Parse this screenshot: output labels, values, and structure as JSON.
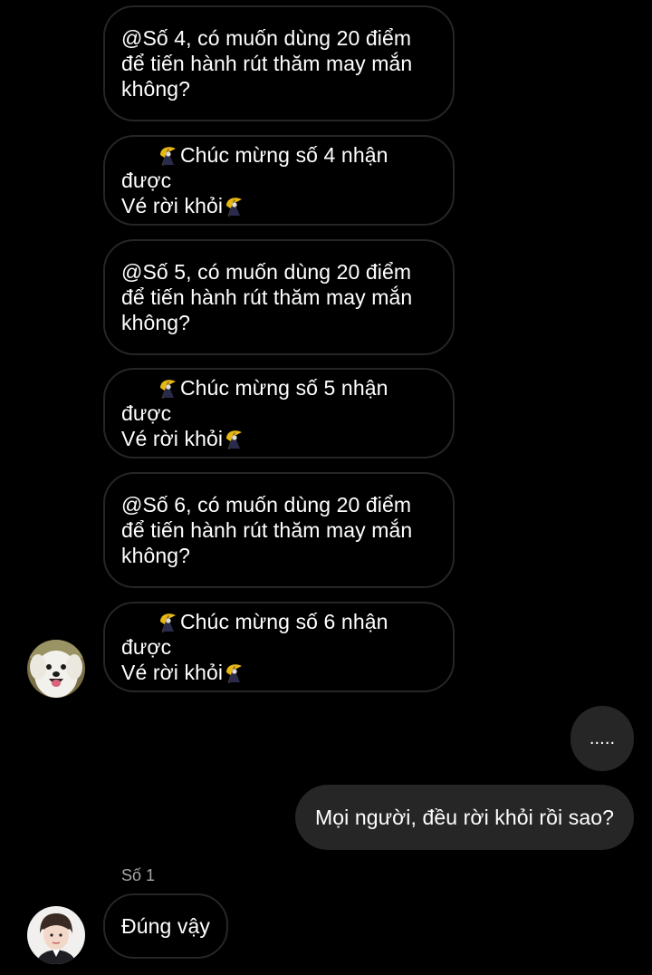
{
  "messages": [
    {
      "lines": [
        "@Số 4, có muốn dùng 20 điểm",
        "để tiến hành rút thăm may mắn",
        "không?"
      ]
    },
    {
      "line1_pre": "Chúc mừng số 4 nhận được",
      "line2_pre": "Vé rời khỏi"
    },
    {
      "lines": [
        "@Số 5, có muốn dùng 20 điểm",
        "để tiến hành rút thăm may mắn",
        "không?"
      ]
    },
    {
      "line1_pre": "Chúc mừng số 5 nhận được",
      "line2_pre": "Vé rời khỏi"
    },
    {
      "lines": [
        "@Số 6, có muốn dùng 20 điểm",
        "để tiến hành rút thăm may mắn",
        "không?"
      ]
    },
    {
      "line1_pre": "Chúc mừng số 6 nhận được",
      "line2_pre": "Vé rời khỏi"
    }
  ],
  "outgoing": [
    {
      "text": "....."
    },
    {
      "text": "Mọi người, đều rời khỏi rồi sao?"
    }
  ],
  "reply": {
    "sender": "Số 1",
    "text": "Đúng vậy"
  },
  "icons": {
    "emoji": "grim-reaper-emoji",
    "avatar_1": "dog-avatar",
    "avatar_2": "person-avatar"
  },
  "colors": {
    "background": "#000000",
    "incoming_border": "#262626",
    "outgoing_fill": "#262626",
    "sender_name": "#a8a8a8"
  }
}
